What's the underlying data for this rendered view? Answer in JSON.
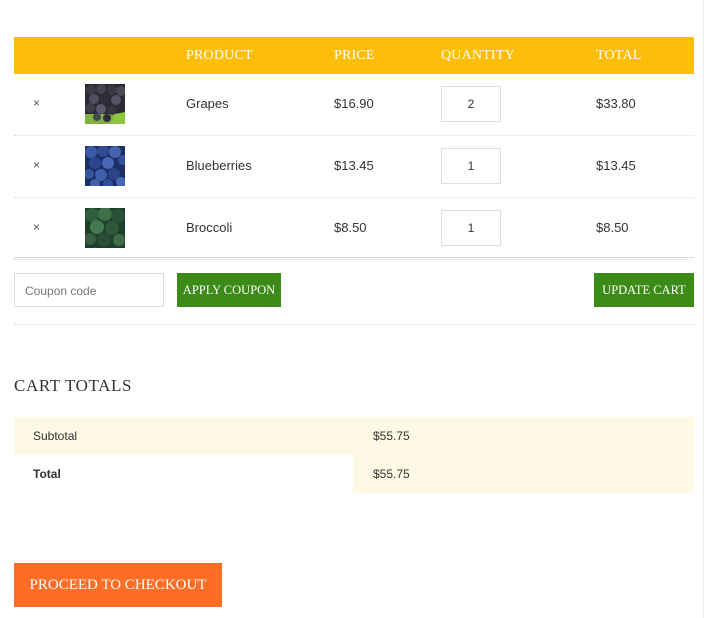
{
  "cart": {
    "headers": {
      "product": "PRODUCT",
      "price": "PRICE",
      "quantity": "QUANTITY",
      "total": "TOTAL"
    },
    "remove_symbol": "×",
    "items": [
      {
        "name": "Grapes",
        "price": "$16.90",
        "quantity": "2",
        "total": "$33.80",
        "thumbnail": "grapes-image"
      },
      {
        "name": "Blueberries",
        "price": "$13.45",
        "quantity": "1",
        "total": "$13.45",
        "thumbnail": "blueberries-image"
      },
      {
        "name": "Broccoli",
        "price": "$8.50",
        "quantity": "1",
        "total": "$8.50",
        "thumbnail": "broccoli-image"
      }
    ],
    "coupon_placeholder": "Coupon code",
    "apply_coupon_label": "APPLY COUPON",
    "update_cart_label": "UPDATE CART"
  },
  "totals": {
    "title": "CART TOTALS",
    "subtotal_label": "Subtotal",
    "subtotal_value": "$55.75",
    "total_label": "Total",
    "total_value": "$55.75"
  },
  "checkout_label": "PROCEED TO CHECKOUT",
  "colors": {
    "header_bg": "#fdbd09",
    "button_green": "#3c8a17",
    "checkout_orange": "#fd6d26",
    "totals_bg": "#fef9e5"
  }
}
